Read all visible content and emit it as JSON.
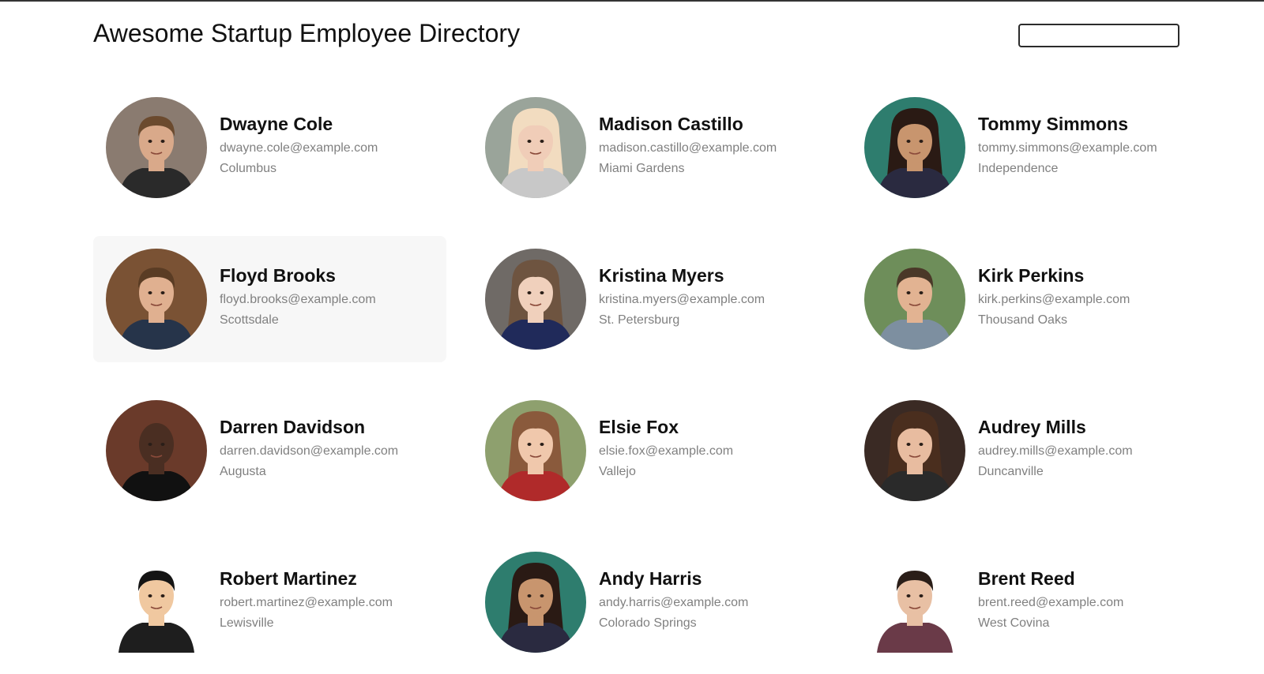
{
  "header": {
    "title": "Awesome Startup Employee Directory",
    "search_placeholder": "",
    "search_value": ""
  },
  "employees": [
    {
      "name": "Dwayne Cole",
      "email": "dwayne.cole@example.com",
      "city": "Columbus",
      "avatar": {
        "bg": "#8a7b70",
        "skin": "#d9a98a",
        "hair": "#6b4a2e",
        "shirt": "#2a2a2a",
        "style": "short",
        "round": true
      }
    },
    {
      "name": "Madison Castillo",
      "email": "madison.castillo@example.com",
      "city": "Miami Gardens",
      "avatar": {
        "bg": "#9aa49a",
        "skin": "#f0cdb8",
        "hair": "#f2dcc0",
        "shirt": "#c8c8c8",
        "style": "long",
        "round": true
      }
    },
    {
      "name": "Tommy Simmons",
      "email": "tommy.simmons@example.com",
      "city": "Independence",
      "avatar": {
        "bg": "#2e7d6e",
        "skin": "#c8956e",
        "hair": "#2a1a14",
        "shirt": "#2a2a40",
        "style": "dreads",
        "round": true
      }
    },
    {
      "name": "Floyd Brooks",
      "email": "floyd.brooks@example.com",
      "city": "Scottsdale",
      "avatar": {
        "bg": "#7a5234",
        "skin": "#e0b090",
        "hair": "#5a3c24",
        "shirt": "#26344a",
        "style": "short",
        "round": true
      }
    },
    {
      "name": "Kristina Myers",
      "email": "kristina.myers@example.com",
      "city": "St. Petersburg",
      "avatar": {
        "bg": "#6f6a66",
        "skin": "#f0d0bc",
        "hair": "#6e5440",
        "shirt": "#202a5a",
        "style": "long",
        "round": true
      }
    },
    {
      "name": "Kirk Perkins",
      "email": "kirk.perkins@example.com",
      "city": "Thousand Oaks",
      "avatar": {
        "bg": "#6e8e5a",
        "skin": "#e2b392",
        "hair": "#4a3828",
        "shirt": "#7d8fa0",
        "style": "short",
        "round": true
      }
    },
    {
      "name": "Darren Davidson",
      "email": "darren.davidson@example.com",
      "city": "Augusta",
      "avatar": {
        "bg": "#6a3a2a",
        "skin": "#4a2e22",
        "hair": "#1a1210",
        "shirt": "#111111",
        "style": "bald",
        "round": true
      }
    },
    {
      "name": "Elsie Fox",
      "email": "elsie.fox@example.com",
      "city": "Vallejo",
      "avatar": {
        "bg": "#8ea06e",
        "skin": "#f0c8ac",
        "hair": "#8a5a3c",
        "shirt": "#b02a2a",
        "style": "long",
        "round": true
      }
    },
    {
      "name": "Audrey Mills",
      "email": "audrey.mills@example.com",
      "city": "Duncanville",
      "avatar": {
        "bg": "#3a2a24",
        "skin": "#e8bca0",
        "hair": "#4a2e1e",
        "shirt": "#2a2a2a",
        "style": "long",
        "round": true
      }
    },
    {
      "name": "Robert Martinez",
      "email": "robert.martinez@example.com",
      "city": "Lewisville",
      "avatar": {
        "bg": "#ffffff",
        "skin": "#f0c8a0",
        "hair": "#141414",
        "shirt": "#1e1e1e",
        "style": "short",
        "round": false
      }
    },
    {
      "name": "Andy Harris",
      "email": "andy.harris@example.com",
      "city": "Colorado Springs",
      "avatar": {
        "bg": "#2e7d6e",
        "skin": "#c8956e",
        "hair": "#2a1a14",
        "shirt": "#2a2a40",
        "style": "dreads",
        "round": true
      }
    },
    {
      "name": "Brent Reed",
      "email": "brent.reed@example.com",
      "city": "West Covina",
      "avatar": {
        "bg": "#ffffff",
        "skin": "#e8c0a4",
        "hair": "#2a1e18",
        "shirt": "#6a3a48",
        "style": "short",
        "round": false
      }
    }
  ],
  "highlighted_index": 3,
  "colors": {
    "name": "#111111",
    "secondary_text": "#808080",
    "highlight_bg": "#f7f7f7",
    "search_border": "#2b2b2b"
  }
}
